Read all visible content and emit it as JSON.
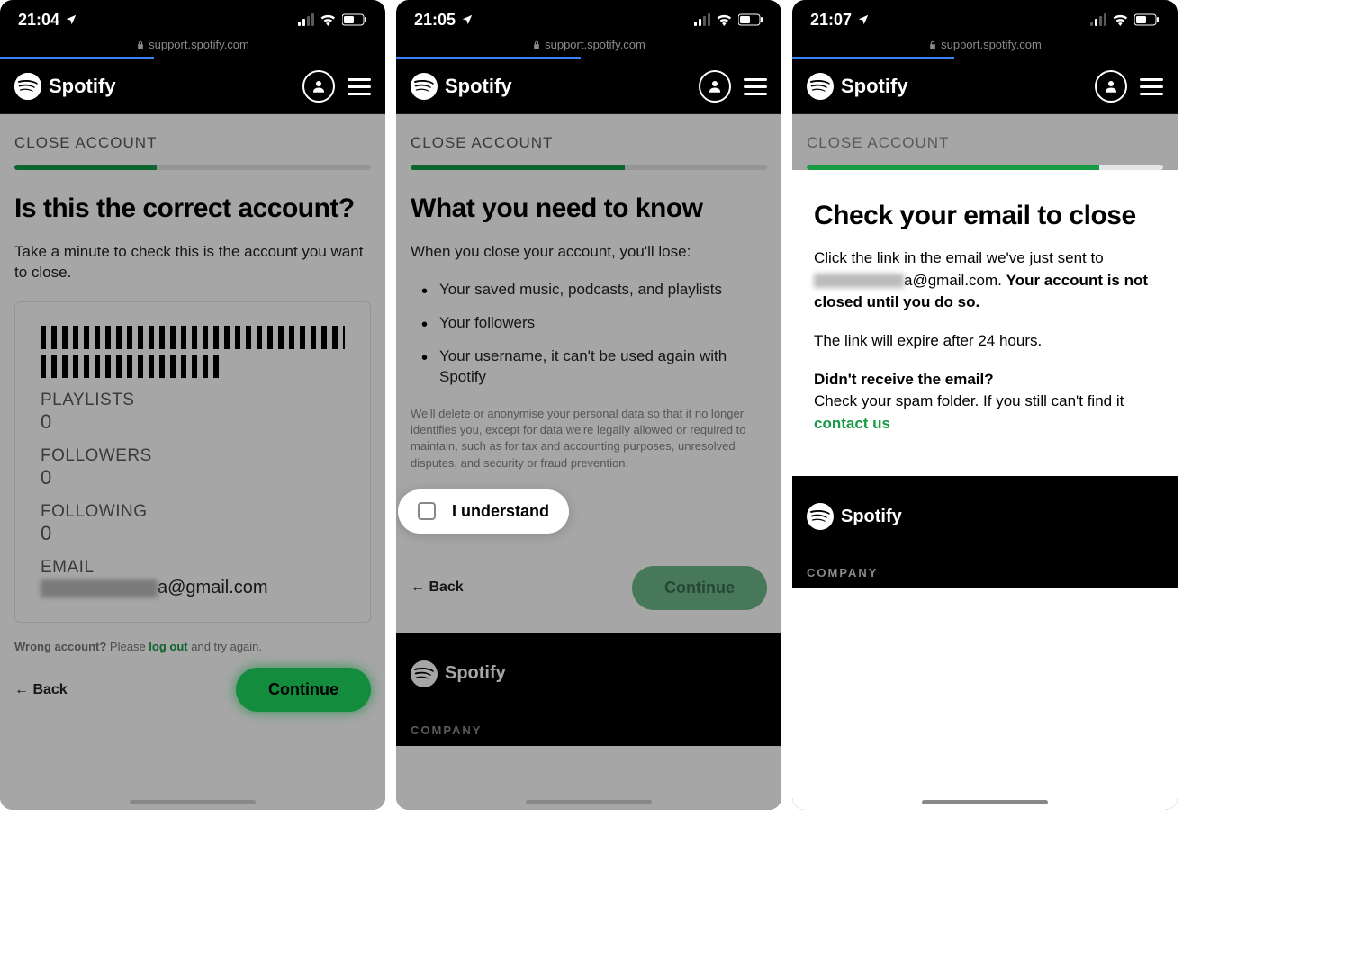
{
  "status": {
    "times": [
      "21:04",
      "21:05",
      "21:07"
    ]
  },
  "url": "support.spotify.com",
  "brand": "Spotify",
  "progress_loading_pct": [
    40,
    48,
    42
  ],
  "eyebrow": "CLOSE ACCOUNT",
  "step_progress_pct": [
    40,
    60,
    82
  ],
  "screen1": {
    "title": "Is this the correct account?",
    "lead": "Take a minute to check this is the account you want to close.",
    "stats": {
      "playlists_label": "PLAYLISTS",
      "playlists_val": "0",
      "followers_label": "FOLLOWERS",
      "followers_val": "0",
      "following_label": "FOLLOWING",
      "following_val": "0",
      "email_label": "EMAIL",
      "email_suffix": "a@gmail.com"
    },
    "wrong_prefix": "Wrong account?",
    "wrong_mid": " Please ",
    "logout": "log out",
    "wrong_suffix": " and try again.",
    "back": "Back",
    "continue": "Continue"
  },
  "screen2": {
    "title": "What you need to know",
    "lead": "When you close your account, you'll lose:",
    "lose": [
      "Your saved music, podcasts, and playlists",
      "Your followers",
      "Your username, it can't be used again with Spotify"
    ],
    "legal": "We'll delete or anonymise your personal data so that it no longer identifies you, except for data we're legally allowed or required to maintain, such as for tax and accounting purposes, unresolved disputes, and security or fraud prevention.",
    "understand": "I understand",
    "back": "Back",
    "continue": "Continue",
    "footer_col": "COMPANY"
  },
  "screen3": {
    "title": "Check your email to close",
    "p1_a": "Click the link in the email we've just sent to ",
    "p1_email_suffix": "a@gmail.com. ",
    "p1_b": "Your account is not closed until you do so.",
    "p2": "The link will expire after 24 hours.",
    "p3_a": "Didn't receive the email?",
    "p3_b": "Check your spam folder. If you still can't find it ",
    "contact": "contact us",
    "footer_col": "COMPANY"
  }
}
